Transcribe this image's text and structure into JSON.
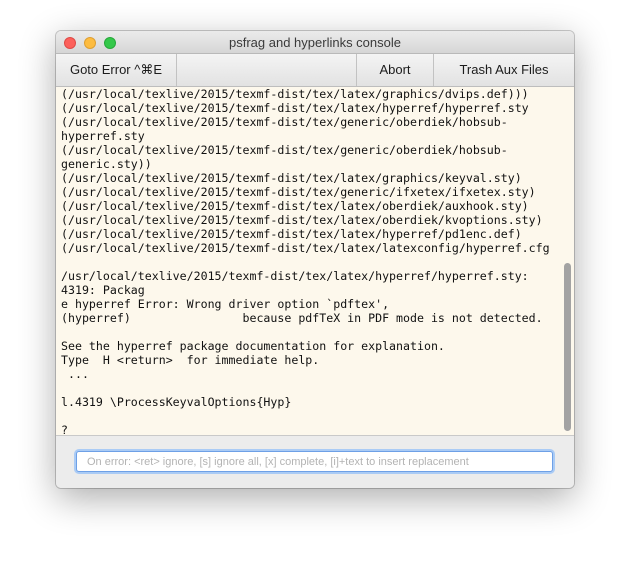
{
  "window": {
    "title": "psfrag and hyperlinks console"
  },
  "toolbar": {
    "goto_error": "Goto Error ^⌘E",
    "abort": "Abort",
    "trash_aux": "Trash Aux Files"
  },
  "console": {
    "lines": [
      "(/usr/local/texlive/2015/texmf-dist/tex/latex/graphics/dvips.def)))",
      "(/usr/local/texlive/2015/texmf-dist/tex/latex/hyperref/hyperref.sty",
      "(/usr/local/texlive/2015/texmf-dist/tex/generic/oberdiek/hobsub-",
      "hyperref.sty",
      "(/usr/local/texlive/2015/texmf-dist/tex/generic/oberdiek/hobsub-",
      "generic.sty))",
      "(/usr/local/texlive/2015/texmf-dist/tex/latex/graphics/keyval.sty)",
      "(/usr/local/texlive/2015/texmf-dist/tex/generic/ifxetex/ifxetex.sty)",
      "(/usr/local/texlive/2015/texmf-dist/tex/latex/oberdiek/auxhook.sty)",
      "(/usr/local/texlive/2015/texmf-dist/tex/latex/oberdiek/kvoptions.sty)",
      "(/usr/local/texlive/2015/texmf-dist/tex/latex/hyperref/pd1enc.def)",
      "(/usr/local/texlive/2015/texmf-dist/tex/latex/latexconfig/hyperref.cfg",
      "",
      "/usr/local/texlive/2015/texmf-dist/tex/latex/hyperref/hyperref.sty:",
      "4319: Packag",
      "e hyperref Error: Wrong driver option `pdftex',",
      "(hyperref)                because pdfTeX in PDF mode is not detected.",
      "",
      "See the hyperref package documentation for explanation.",
      "Type  H <return>  for immediate help.",
      " ...",
      "",
      "l.4319 \\ProcessKeyvalOptions{Hyp}",
      "",
      "?"
    ]
  },
  "input": {
    "placeholder": "On error: <ret> ignore, [s] ignore all, [x] complete, [i]+text to insert replacement",
    "value": ""
  }
}
